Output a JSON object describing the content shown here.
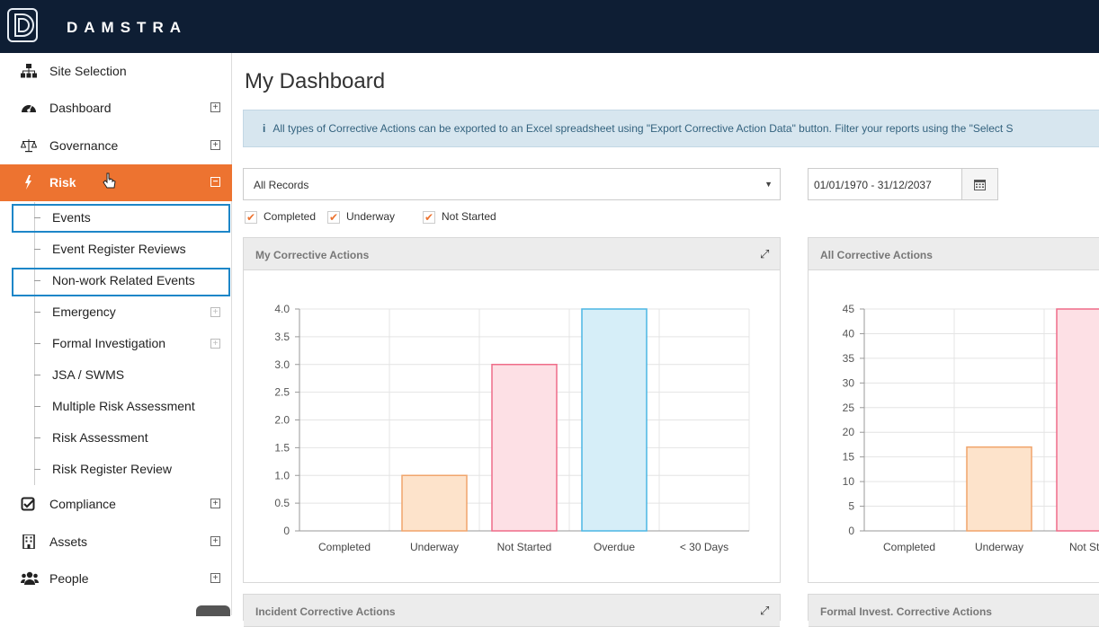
{
  "brand": {
    "name": "DAMSTRA"
  },
  "sidebar": {
    "items": [
      {
        "label": "Site Selection",
        "icon": "sitemap-icon"
      },
      {
        "label": "Dashboard",
        "icon": "dashboard-icon",
        "toggle": "⊞"
      },
      {
        "label": "Governance",
        "icon": "balance-scale-icon",
        "toggle": "⊞"
      },
      {
        "label": "Risk",
        "icon": "bolt-icon",
        "toggle": "⊟",
        "active": true
      },
      {
        "label": "Compliance",
        "icon": "check-square-icon",
        "toggle": "⊞"
      },
      {
        "label": "Assets",
        "icon": "building-icon",
        "toggle": "⊞"
      },
      {
        "label": "People",
        "icon": "users-icon",
        "toggle": "⊞"
      }
    ],
    "risk_subitems": [
      {
        "label": "Events",
        "highlighted": true
      },
      {
        "label": "Event Register Reviews"
      },
      {
        "label": "Non-work Related Events",
        "highlighted": true
      },
      {
        "label": "Emergency",
        "expandable": true
      },
      {
        "label": "Formal Investigation",
        "expandable": true
      },
      {
        "label": "JSA / SWMS"
      },
      {
        "label": "Multiple Risk Assessment"
      },
      {
        "label": "Risk Assessment"
      },
      {
        "label": "Risk Register Review"
      }
    ],
    "accent_color": "#ed7330",
    "highlight_color": "#1d86c8"
  },
  "main": {
    "title": "My Dashboard",
    "info": "All types of Corrective Actions can be exported to an Excel spreadsheet using \"Export Corrective Action Data\" button. Filter your reports using the \"Select S",
    "filter": {
      "selected": "All Records"
    },
    "date_range": "01/01/1970 - 31/12/2037",
    "checkboxes": [
      "Completed",
      "Underway",
      "Not Started"
    ],
    "panels": {
      "my_ca": "My Corrective Actions",
      "all_ca": "All Corrective Actions",
      "incident_ca": "Incident Corrective Actions",
      "formal_ca": "Formal Invest. Corrective Actions"
    }
  },
  "chart_data": [
    {
      "type": "bar",
      "title": "My Corrective Actions",
      "categories": [
        "Completed",
        "Underway",
        "Not Started",
        "Overdue",
        "< 30 Days"
      ],
      "values": [
        0,
        1,
        3,
        4,
        0
      ],
      "ylim": [
        0,
        4
      ],
      "yticks": [
        "0",
        "0.5",
        "1.0",
        "1.5",
        "2.0",
        "2.5",
        "3.0",
        "3.5",
        "4.0"
      ],
      "colors": {
        "Underway": {
          "fill": "#fde3cb",
          "stroke": "#f0a46b"
        },
        "Not Started": {
          "fill": "#fde0e5",
          "stroke": "#ef6c89"
        },
        "Overdue": {
          "fill": "#d6eef8",
          "stroke": "#4bb6e4"
        }
      },
      "grid": true
    },
    {
      "type": "bar",
      "title": "All Corrective Actions",
      "categories": [
        "Completed",
        "Underway",
        "Not Star"
      ],
      "values": [
        0,
        17,
        45
      ],
      "ylim": [
        0,
        45
      ],
      "yticks": [
        "0",
        "5",
        "10",
        "15",
        "20",
        "25",
        "30",
        "35",
        "40",
        "45"
      ],
      "grid": true
    }
  ]
}
